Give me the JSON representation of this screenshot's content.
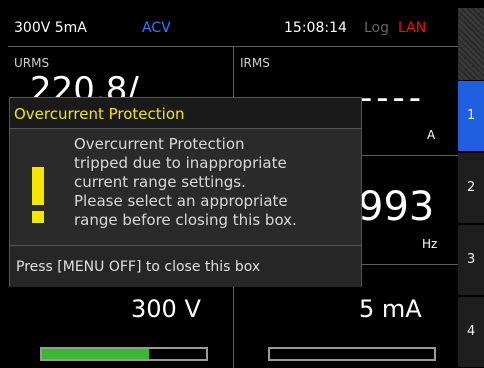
{
  "status_bar": {
    "range": "300V 5mA",
    "mode": "ACV",
    "time": "15:08:14",
    "log": "Log",
    "lan": "LAN"
  },
  "cells": {
    "urms": {
      "label": "URMS",
      "value": "220.8/"
    },
    "irms": {
      "label": "IRMS",
      "value": "----",
      "unit": "A"
    },
    "freq": {
      "value": "993",
      "unit": "Hz"
    },
    "urange": {
      "value": "300 V",
      "bar_fill": 0.65
    },
    "irange": {
      "value": "5 mA",
      "bar_fill": 0.0
    }
  },
  "tabs": [
    "1",
    "2",
    "3",
    "4"
  ],
  "dialog": {
    "title": "Overcurrent Protection",
    "message_lines": [
      "Overcurrent Protection",
      "tripped due to inappropriate",
      "current range settings.",
      "Please select an appropriate",
      "range before closing this box."
    ],
    "footer": "Press [MENU OFF] to close this box"
  },
  "colors": {
    "accent_blue": "#1f5fe0",
    "warning_yellow": "#f3e600",
    "bar_green": "#37b82f",
    "lan_red": "#e11111"
  }
}
